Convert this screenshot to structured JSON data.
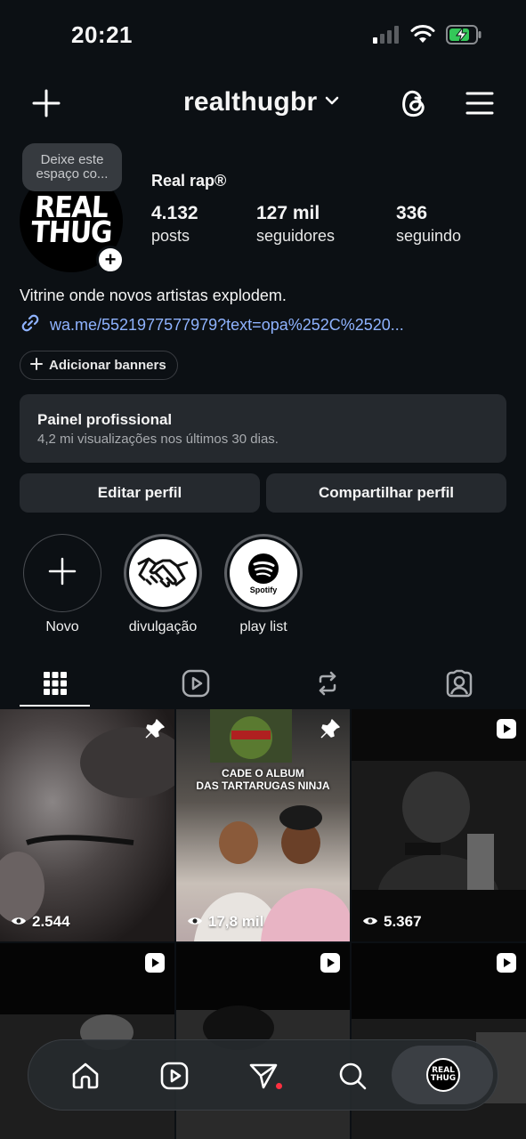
{
  "status_bar": {
    "time": "20:21",
    "icons": [
      "cellular-signal-icon",
      "wifi-icon",
      "battery-charging-icon"
    ],
    "battery_color": "#34c759"
  },
  "header": {
    "username": "realthugbr",
    "icons": [
      "plus-icon",
      "chevron-down-icon",
      "threads-icon",
      "hamburger-menu-icon"
    ]
  },
  "profile": {
    "note": "Deixe este espaço co...",
    "avatar_text": [
      "REAL",
      "THUG"
    ],
    "display_name": "Real rap®",
    "stats": [
      {
        "value": "4.132",
        "label": "posts"
      },
      {
        "value": "127 mil",
        "label": "seguidores"
      },
      {
        "value": "336",
        "label": "seguindo"
      }
    ],
    "bio": "Vitrine onde novos artistas explodem.",
    "link": "wa.me/5521977577979?text=opa%252C%2520...",
    "link_color": "#8fb3ff",
    "add_banners": "Adicionar banners"
  },
  "pro_panel": {
    "title": "Painel profissional",
    "subtitle": "4,2 mi visualizações nos últimos 30 dias."
  },
  "buttons": {
    "edit": "Editar perfil",
    "share": "Compartilhar perfil"
  },
  "highlights": [
    {
      "label": "Novo",
      "icon": "plus-icon"
    },
    {
      "label": "divulgação",
      "icon": "handshake-icon"
    },
    {
      "label": "play list",
      "icon": "spotify-icon",
      "icon_text": "Spotify"
    }
  ],
  "tabs": [
    "grid-icon",
    "reels-icon",
    "reposts-icon",
    "tagged-icon"
  ],
  "grid": {
    "posts": [
      {
        "views": "2.544",
        "badge": "pin-icon"
      },
      {
        "views": "17,8 mil",
        "badge": "pin-icon",
        "overlay_text": [
          "CADE O ALBUM",
          "DAS TARTARUGAS NINJA"
        ]
      },
      {
        "views": "5.367",
        "badge": "reel-icon"
      },
      {
        "badge": "reel-icon"
      },
      {
        "badge": "reel-icon"
      },
      {
        "badge": "reel-icon"
      }
    ]
  },
  "bottom_nav": {
    "items": [
      "home-icon",
      "reels-icon",
      "direct-messages-icon",
      "search-icon",
      "profile-avatar"
    ],
    "avatar_text": [
      "REAL",
      "THUG"
    ],
    "notification_color": "#ff3040"
  }
}
